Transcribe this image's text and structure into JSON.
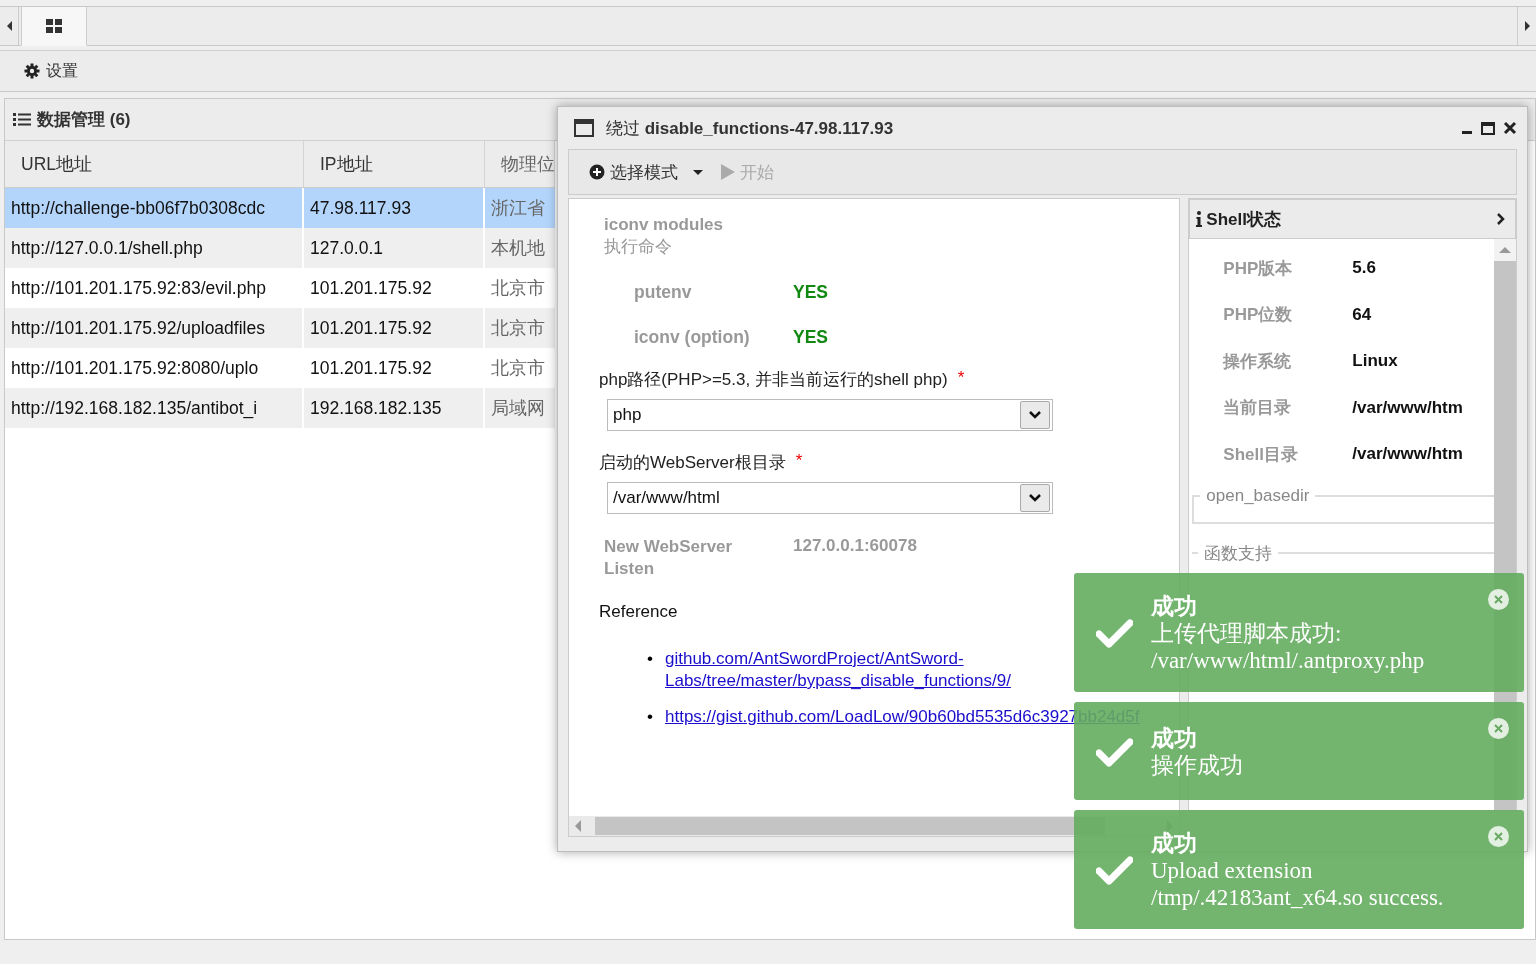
{
  "top_tabs": [
    {
      "kind": "grid",
      "selected": true
    }
  ],
  "toolbar": {
    "buttons": [
      {
        "kind": "settings",
        "label": "设置"
      }
    ]
  },
  "data_panel": {
    "title": "数据管理 (6)",
    "columns": [
      "URL地址",
      "IP地址",
      "物理位"
    ],
    "rows": [
      {
        "cells": [
          "http://challenge-bb06f7b0308cdc",
          "47.98.117.93",
          "浙江省"
        ],
        "selected": true
      },
      {
        "cells": [
          "http://127.0.0.1/shell.php",
          "127.0.0.1",
          "本机地"
        ],
        "selected": false
      },
      {
        "cells": [
          "http://101.201.175.92:83/evil.php",
          "101.201.175.92",
          "北京市"
        ],
        "selected": false
      },
      {
        "cells": [
          "http://101.201.175.92/uploadfiles",
          "101.201.175.92",
          "北京市"
        ],
        "selected": false
      },
      {
        "cells": [
          "http://101.201.175.92:8080/uplo",
          "101.201.175.92",
          "北京市"
        ],
        "selected": false
      },
      {
        "cells": [
          "http://192.168.182.135/antibot_i",
          "192.168.182.135",
          "局域网"
        ],
        "selected": false
      }
    ]
  },
  "dialog": {
    "title": "绕过 **disable_functions-47.98.117.93**",
    "toolbar": [
      {
        "kind": "dropdown",
        "label": "选择模式",
        "disabled": false
      },
      {
        "kind": "play",
        "label": "开始",
        "disabled": true
      }
    ],
    "mode": {
      "title": "iconv modules",
      "subtitle": "执行命令"
    },
    "checks": [
      {
        "name": "putenv",
        "result": "YES"
      },
      {
        "name": "iconv (option)",
        "result": "YES"
      }
    ],
    "fields": [
      {
        "label": "php路径(PHP>=5.3, 并非当前运行的shell php)",
        "marker": "*",
        "value": "php"
      },
      {
        "label": "启动的WebServer根目录",
        "marker": "*",
        "value": "/var/www/html"
      }
    ],
    "listen": {
      "label": "New WebServer Listen",
      "value": "127.0.0.1:60078"
    },
    "reference": {
      "title": "Reference",
      "bullet": "•",
      "links": [
        "github.com/AntSwordProject/AntSword-Labs/tree/master/bypass_disable_functions/9/",
        "https://gist.github.com/LoadLow/90b60bd5535d6c3927bb24d5f"
      ]
    },
    "shell_status": {
      "title": "Shell状态",
      "info": [
        {
          "label": "PHP版本",
          "value": "5.6"
        },
        {
          "label": "PHP位数",
          "value": "64"
        },
        {
          "label": "操作系统",
          "value": "Linux"
        },
        {
          "label": "当前目录",
          "value": "/var/www/htm"
        },
        {
          "label": "Shell目录",
          "value": "/var/www/htm"
        }
      ],
      "open_basedir": "open_basedir",
      "functions": {
        "legend": "函数支持"
      }
    }
  },
  "toasts": [
    {
      "title": "成功",
      "message": "上传代理脚本成功: /var/www/html/.antproxy.php"
    },
    {
      "title": "成功",
      "message": "操作成功"
    },
    {
      "title": "成功",
      "message": "Upload extension /tmp/.42183ant_x64.so success."
    }
  ]
}
